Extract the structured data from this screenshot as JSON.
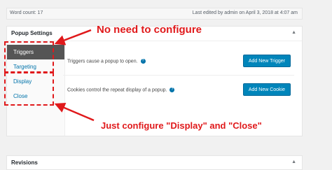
{
  "top_bar": {
    "word_count": "Word count: 17",
    "last_edited": "Last edited by admin on April 3, 2018 at 4:07 am"
  },
  "popup_settings": {
    "title": "Popup Settings",
    "toggle_glyph": "▲",
    "tabs": [
      {
        "label": "Triggers",
        "active": true
      },
      {
        "label": "Targeting",
        "active": false
      },
      {
        "label": "Display",
        "active": false
      },
      {
        "label": "Close",
        "active": false
      }
    ],
    "rows": [
      {
        "description": "Triggers cause a popup to open.",
        "help_glyph": "?",
        "button": "Add New Trigger"
      },
      {
        "description": "Cookies control the repeat display of a popup.",
        "help_glyph": "?",
        "button": "Add New Cookie"
      }
    ]
  },
  "revisions": {
    "title": "Revisions",
    "toggle_glyph": "▲"
  },
  "annotations": {
    "top_note": "No need to configure",
    "bottom_note": "Just configure \"Display\" and \"Close\"",
    "color": "#e0191b"
  }
}
